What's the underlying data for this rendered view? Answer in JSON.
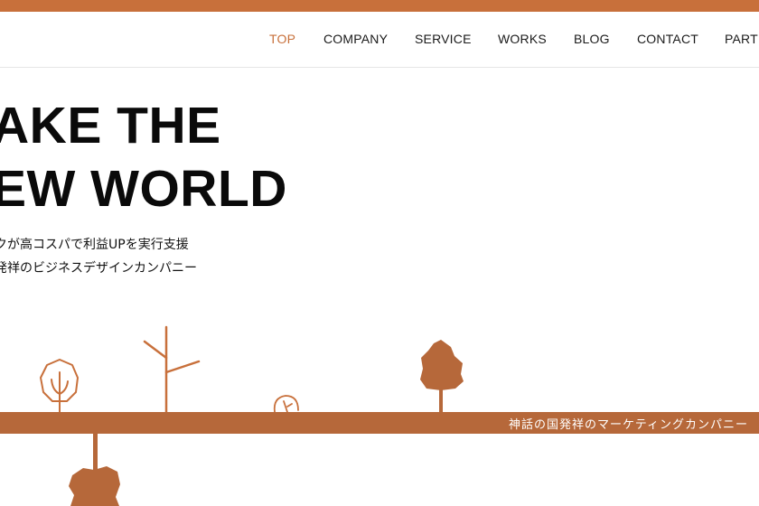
{
  "nav": {
    "items": [
      {
        "label": "TOP",
        "active": true
      },
      {
        "label": "COMPANY",
        "active": false
      },
      {
        "label": "SERVICE",
        "active": false
      },
      {
        "label": "WORKS",
        "active": false
      },
      {
        "label": "BLOG",
        "active": false
      },
      {
        "label": "CONTACT",
        "active": false
      },
      {
        "label": "PARTN",
        "active": false
      }
    ]
  },
  "hero": {
    "title_line1": "AKE THE",
    "title_line2": "EW WORLD",
    "subtitle_line1": "クが高コスパで利益UPを実行支援",
    "subtitle_line2": "発祥のビジネスデザインカンパニー"
  },
  "band": {
    "text": "神話の国発祥のマーケティングカンパニー"
  },
  "colors": {
    "accent": "#c8703b",
    "ground": "#b6683a",
    "text": "#0a0a0a"
  },
  "icons": [
    "round-tree-outline-icon",
    "bare-tree-icon",
    "small-bush-icon",
    "filled-tree-icon",
    "roots-icon"
  ]
}
